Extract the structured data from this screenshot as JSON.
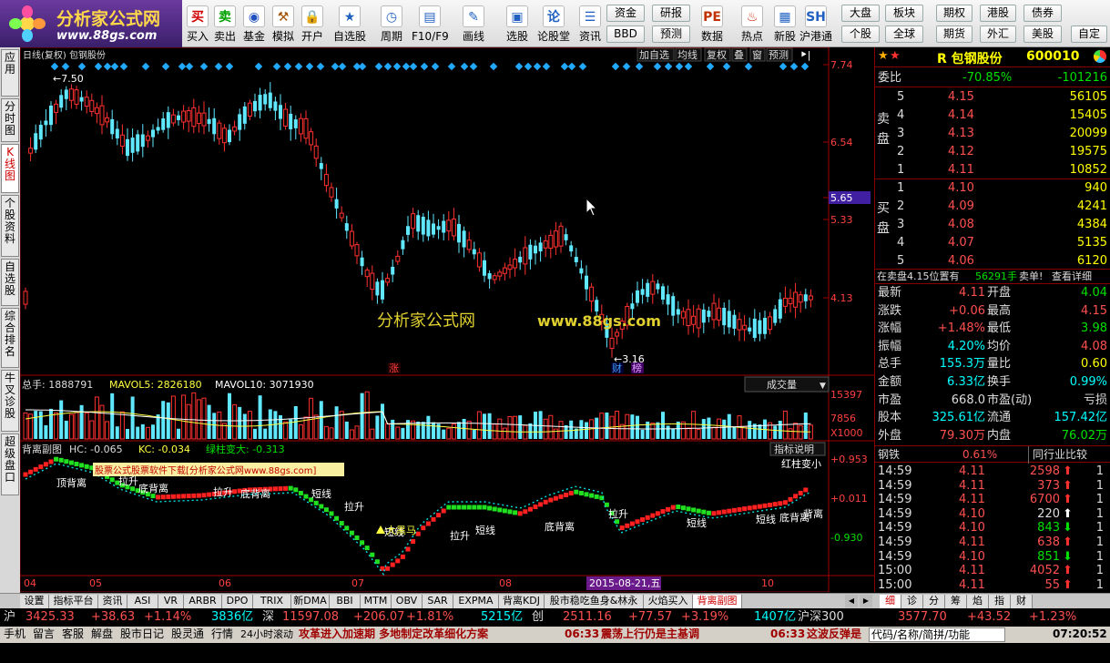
{
  "app": {
    "logo_cn": "分析家公式网",
    "logo_url": "www.88gs.com"
  },
  "toolbar": {
    "buttons": [
      {
        "label": "买入",
        "icon": "买",
        "color": "#d00000"
      },
      {
        "label": "卖出",
        "icon": "卖",
        "color": "#00a000"
      },
      {
        "label": "基金",
        "icon": "◉",
        "color": "#2050c0"
      },
      {
        "label": "模拟",
        "icon": "⚒",
        "color": "#a05000"
      },
      {
        "label": "开户",
        "icon": "🔒",
        "color": "#806000"
      },
      {
        "label": "自选股",
        "icon": "★",
        "color": "#2060c0"
      },
      {
        "label": "周期",
        "icon": "◷",
        "color": "#2060c0"
      },
      {
        "label": "F10/F9",
        "icon": "▤",
        "color": "#2060c0"
      },
      {
        "label": "画线",
        "icon": "✎",
        "color": "#2060c0"
      },
      {
        "label": "选股",
        "icon": "▣",
        "color": "#2060c0"
      },
      {
        "label": "论股堂",
        "icon": "论",
        "color": "#2060c0"
      },
      {
        "label": "资讯",
        "icon": "☰",
        "color": "#2060c0"
      },
      {
        "label": "数据",
        "icon": "PE",
        "color": "#c03000"
      },
      {
        "label": "热点",
        "icon": "♨",
        "color": "#d02000"
      },
      {
        "label": "新股",
        "icon": "▦",
        "color": "#2060c0"
      },
      {
        "label": "沪港通",
        "icon": "SH",
        "color": "#2060c0"
      }
    ],
    "small_buttons": [
      "资金",
      "BBD",
      "研报",
      "预测",
      "大盘",
      "个股",
      "板块",
      "全球",
      "期权",
      "期货",
      "港股",
      "外汇",
      "债券",
      "美股",
      "自定"
    ]
  },
  "left_tabs": [
    {
      "label": "应用",
      "on": false
    },
    {
      "label": "分时图",
      "on": false
    },
    {
      "label": "K线图",
      "on": true
    },
    {
      "label": "个股资料",
      "on": false
    },
    {
      "label": "自选股",
      "on": false
    },
    {
      "label": "综合排名",
      "on": false
    },
    {
      "label": "牛叉诊股",
      "on": false
    },
    {
      "label": "超级盘口",
      "on": false
    }
  ],
  "chart": {
    "title": "日线(复权)  包钢股份",
    "top_buttons": [
      "加自选",
      "均线",
      "复权",
      "叠",
      "窗",
      "预测"
    ],
    "price_labels": [
      "7.74",
      "6.54",
      "5.65",
      "5.33",
      "4.13"
    ],
    "annotations": {
      "high": "7.50",
      "low": "3.16",
      "zhang": "涨",
      "cai": "财",
      "lou": "榜"
    },
    "watermark_cn": "分析家公式网",
    "watermark_url": "www.88gs.com",
    "volume": {
      "legend_total": "总手: 1888791",
      "legend_ma5": "MAVOL5: 2826180",
      "legend_ma10": "MAVOL10: 3071930",
      "selector": "成交量",
      "labels": [
        "15397",
        "7856",
        "X1000"
      ]
    },
    "indicator": {
      "name": "背离副图",
      "hc": "HC: -0.065",
      "kc": "KC: -0.034",
      "green": "绿柱变大: -0.313",
      "explain_btn": "指标说明",
      "red_note": "红柱变小",
      "labels": [
        "+0.953",
        "+0.011",
        "-0.930"
      ],
      "promo": "股票公式股票软件下载[分析家公式网www.88gs.com]",
      "texts": [
        "顶背离",
        "拉升",
        "底背离",
        "拉升",
        "底背离",
        "短线",
        "拉升",
        "短线",
        "大黑马",
        "短线",
        "拉升",
        "底背离",
        "拉升",
        "短线",
        "短线",
        "底背离",
        "背离"
      ]
    },
    "dates": [
      "04",
      "05",
      "06",
      "07",
      "08",
      "10"
    ],
    "date_highlight": "2015-08-21,五"
  },
  "quote": {
    "name": "R 包钢股份",
    "code": "600010",
    "weibi_label": "委比",
    "weibi": "-70.85%",
    "weicha": "-101216",
    "sell_label": "卖盘",
    "buy_label": "买盘",
    "sell": [
      [
        "5",
        "4.15",
        "56105"
      ],
      [
        "4",
        "4.14",
        "15405"
      ],
      [
        "3",
        "4.13",
        "20099"
      ],
      [
        "2",
        "4.12",
        "19575"
      ],
      [
        "1",
        "4.11",
        "10852"
      ]
    ],
    "buy": [
      [
        "1",
        "4.10",
        "940"
      ],
      [
        "2",
        "4.09",
        "4241"
      ],
      [
        "3",
        "4.08",
        "4384"
      ],
      [
        "4",
        "4.07",
        "5135"
      ],
      [
        "5",
        "4.06",
        "6120"
      ]
    ],
    "notice": "在卖盘4.15位置有",
    "notice_qty": "56291手",
    "notice_sell": "卖单!",
    "notice_detail": "查看详细",
    "stats": [
      [
        "最新",
        "4.11",
        "开盘",
        "4.04"
      ],
      [
        "涨跌",
        "+0.06",
        "最高",
        "4.15"
      ],
      [
        "涨幅",
        "+1.48%",
        "最低",
        "3.98"
      ],
      [
        "振幅",
        "4.20%",
        "均价",
        "4.08"
      ],
      [
        "总手",
        "155.3万",
        "量比",
        "0.60"
      ],
      [
        "金额",
        "6.33亿",
        "换手",
        "0.99%"
      ],
      [
        "市盈",
        "668.0",
        "市盈(动)",
        "亏损"
      ],
      [
        "股本",
        "325.61亿",
        "流通",
        "157.42亿"
      ],
      [
        "外盘",
        "79.30万",
        "内盘",
        "76.02万"
      ]
    ],
    "industry": "钢铁",
    "industry_pct": "0.61%",
    "industry_btn": "同行业比较",
    "ticks": [
      [
        "14:59",
        "4.11",
        "2598",
        "up",
        "1"
      ],
      [
        "14:59",
        "4.11",
        "373",
        "up",
        "1"
      ],
      [
        "14:59",
        "4.11",
        "6700",
        "up",
        "1"
      ],
      [
        "14:59",
        "4.10",
        "220",
        "upw",
        "1"
      ],
      [
        "14:59",
        "4.10",
        "843",
        "down",
        "1"
      ],
      [
        "14:59",
        "4.11",
        "638",
        "up",
        "1"
      ],
      [
        "14:59",
        "4.10",
        "851",
        "down",
        "1"
      ],
      [
        "15:00",
        "4.11",
        "4052",
        "up",
        "1"
      ],
      [
        "15:00",
        "4.11",
        "55",
        "up",
        "1"
      ]
    ]
  },
  "bottom_tabs": [
    "设置",
    "指标平台",
    "资讯",
    "ASI",
    "VR",
    "ARBR",
    "DPO",
    "TRIX",
    "新DMA",
    "BBI",
    "MTM",
    "OBV",
    "SAR",
    "EXPMA",
    "背离KDJ",
    "股市稳吃鱼身&林永",
    "火焰买入",
    "背离副图"
  ],
  "right_tabs": [
    "细",
    "诊",
    "分",
    "筹",
    "焰",
    "指",
    "财"
  ],
  "index_bar": {
    "sh_label": "沪",
    "sh": "3425.33",
    "sh_chg": "+38.63",
    "sh_pct": "+1.14%",
    "sh_amt": "3836亿",
    "sz_label": "深",
    "sz": "11597.08",
    "sz_chg": "+206.07",
    "sz_pct": "+1.81%",
    "sz_amt": "5215亿",
    "cy_label": "创",
    "cy": "2511.16",
    "cy_chg": "+77.57",
    "cy_pct": "+3.19%",
    "cy_amt": "1407亿",
    "hs_label": "沪深300",
    "hs": "3577.70",
    "hs_chg": "+43.52",
    "hs_pct": "+1.23%"
  },
  "status": {
    "items": [
      "手机",
      "留言",
      "客服",
      "解盘",
      "股市日记",
      "股灵通",
      "行情",
      "24小时滚动"
    ],
    "news1": "攻革进入加速期 多地制定改革细化方案",
    "time1": "06:33",
    "news2": "震荡上行仍是主基调",
    "time2": "06:33",
    "news3": "这波反弹是",
    "search": "代码/名称/简拼/功能",
    "clock": "07:20:52"
  }
}
